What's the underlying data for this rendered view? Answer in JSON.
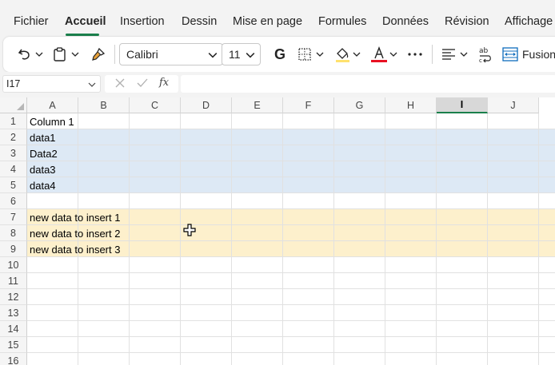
{
  "menu": {
    "tabs": [
      {
        "label": "Fichier"
      },
      {
        "label": "Accueil",
        "active": true
      },
      {
        "label": "Insertion"
      },
      {
        "label": "Dessin"
      },
      {
        "label": "Mise en page"
      },
      {
        "label": "Formules"
      },
      {
        "label": "Données"
      },
      {
        "label": "Révision"
      },
      {
        "label": "Affichage"
      }
    ]
  },
  "ribbon": {
    "font_name": "Calibri",
    "font_size": "11",
    "bold_label": "G",
    "merge_label": "Fusion",
    "accent_colors": {
      "font_color": "#e81123",
      "fill_color": "#ffe16e"
    }
  },
  "formula_bar": {
    "name_box": "I17",
    "formula": ""
  },
  "sheet": {
    "columns": [
      "A",
      "B",
      "C",
      "D",
      "E",
      "F",
      "G",
      "H",
      "I",
      "J"
    ],
    "selected_column": "I",
    "rows": [
      "1",
      "2",
      "3",
      "4",
      "5",
      "6",
      "7",
      "8",
      "9",
      "10",
      "11",
      "12",
      "13",
      "14",
      "15",
      "16"
    ],
    "cells": {
      "A1": "Column 1",
      "A2": "data1",
      "A3": "Data2",
      "A4": "data3",
      "A5": "data4",
      "A7": "new data to insert 1",
      "A8": "new data to insert 2",
      "A9": "new data to insert 3"
    },
    "highlight_colors": {
      "blue": "#dde9f5",
      "yellow": "#fdf0cc"
    }
  }
}
